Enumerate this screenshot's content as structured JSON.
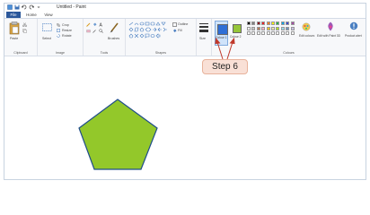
{
  "window": {
    "title": "Untitled - Paint"
  },
  "tabs": [
    {
      "label": "File"
    },
    {
      "label": "Home"
    },
    {
      "label": "View"
    }
  ],
  "ribbon": {
    "clipboard": {
      "paste_label": "Paste",
      "group_label": "Clipboard"
    },
    "image": {
      "select_label": "Select",
      "crop_label": "Crop",
      "resize_label": "Resize",
      "rotate_label": "Rotate",
      "group_label": "Image"
    },
    "tools": {
      "brushes_label": "Brushes",
      "group_label": "Tools"
    },
    "shapes": {
      "outline_label": "Outline",
      "fill_label": "Fill",
      "group_label": "Shapes"
    },
    "size": {
      "label": "Size"
    },
    "colors": {
      "color1_label": "Colour 1",
      "color2_label": "Colour 2",
      "edit_colors_label": "Edit colours",
      "paint3d_label": "Edit with Paint 3D",
      "product_alert_label": "Product alert",
      "group_label": "Colours",
      "color1": "#2f6fd6",
      "color2": "#96c63a",
      "palette_row1": [
        "#000000",
        "#7f7f7f",
        "#880015",
        "#ed1c24",
        "#ff7f27",
        "#fff200",
        "#22b14c",
        "#00a2e8",
        "#3f48cc",
        "#a349a4"
      ],
      "palette_row2": [
        "#ffffff",
        "#c3c3c3",
        "#b97a57",
        "#ffaec9",
        "#ffc90e",
        "#efe4b0",
        "#b5e61d",
        "#99d9ea",
        "#7092be",
        "#c8bfe7"
      ],
      "palette_row3": [
        "#ffffff",
        "#ffffff",
        "#ffffff",
        "#ffffff",
        "#ffffff",
        "#ffffff",
        "#ffffff",
        "#ffffff",
        "#ffffff",
        "#ffffff"
      ]
    }
  },
  "annotation": {
    "step_label": "Step 6"
  },
  "canvas": {
    "shape_fill": "#93c82a",
    "shape_stroke": "#1f4d8a"
  }
}
